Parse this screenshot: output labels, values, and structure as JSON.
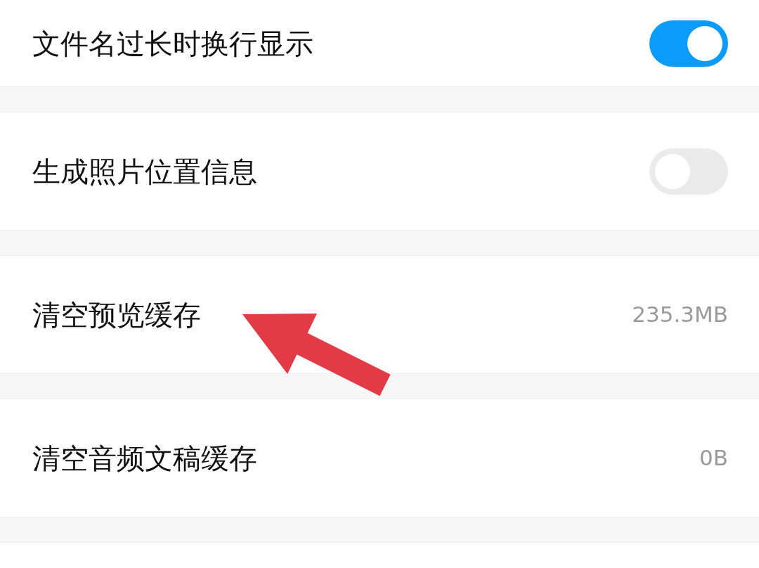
{
  "settings": [
    {
      "kind": "toggle",
      "label": "文件名过长时换行显示",
      "on": true
    },
    {
      "kind": "toggle",
      "label": "生成照片位置信息",
      "on": false
    },
    {
      "kind": "value",
      "label": "清空预览缓存",
      "value": "235.3MB"
    },
    {
      "kind": "value",
      "label": "清空音频文稿缓存",
      "value": "0B"
    }
  ]
}
